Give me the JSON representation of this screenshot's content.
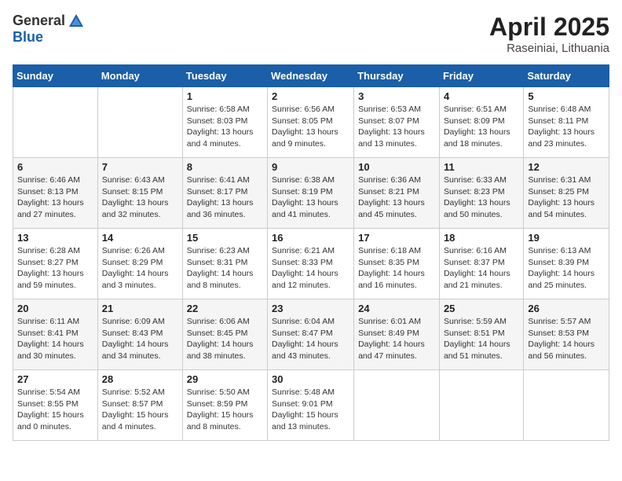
{
  "header": {
    "logo_general": "General",
    "logo_blue": "Blue",
    "month": "April 2025",
    "location": "Raseiniai, Lithuania"
  },
  "days_of_week": [
    "Sunday",
    "Monday",
    "Tuesday",
    "Wednesday",
    "Thursday",
    "Friday",
    "Saturday"
  ],
  "weeks": [
    [
      {
        "day": "",
        "info": ""
      },
      {
        "day": "",
        "info": ""
      },
      {
        "day": "1",
        "info": "Sunrise: 6:58 AM\nSunset: 8:03 PM\nDaylight: 13 hours\nand 4 minutes."
      },
      {
        "day": "2",
        "info": "Sunrise: 6:56 AM\nSunset: 8:05 PM\nDaylight: 13 hours\nand 9 minutes."
      },
      {
        "day": "3",
        "info": "Sunrise: 6:53 AM\nSunset: 8:07 PM\nDaylight: 13 hours\nand 13 minutes."
      },
      {
        "day": "4",
        "info": "Sunrise: 6:51 AM\nSunset: 8:09 PM\nDaylight: 13 hours\nand 18 minutes."
      },
      {
        "day": "5",
        "info": "Sunrise: 6:48 AM\nSunset: 8:11 PM\nDaylight: 13 hours\nand 23 minutes."
      }
    ],
    [
      {
        "day": "6",
        "info": "Sunrise: 6:46 AM\nSunset: 8:13 PM\nDaylight: 13 hours\nand 27 minutes."
      },
      {
        "day": "7",
        "info": "Sunrise: 6:43 AM\nSunset: 8:15 PM\nDaylight: 13 hours\nand 32 minutes."
      },
      {
        "day": "8",
        "info": "Sunrise: 6:41 AM\nSunset: 8:17 PM\nDaylight: 13 hours\nand 36 minutes."
      },
      {
        "day": "9",
        "info": "Sunrise: 6:38 AM\nSunset: 8:19 PM\nDaylight: 13 hours\nand 41 minutes."
      },
      {
        "day": "10",
        "info": "Sunrise: 6:36 AM\nSunset: 8:21 PM\nDaylight: 13 hours\nand 45 minutes."
      },
      {
        "day": "11",
        "info": "Sunrise: 6:33 AM\nSunset: 8:23 PM\nDaylight: 13 hours\nand 50 minutes."
      },
      {
        "day": "12",
        "info": "Sunrise: 6:31 AM\nSunset: 8:25 PM\nDaylight: 13 hours\nand 54 minutes."
      }
    ],
    [
      {
        "day": "13",
        "info": "Sunrise: 6:28 AM\nSunset: 8:27 PM\nDaylight: 13 hours\nand 59 minutes."
      },
      {
        "day": "14",
        "info": "Sunrise: 6:26 AM\nSunset: 8:29 PM\nDaylight: 14 hours\nand 3 minutes."
      },
      {
        "day": "15",
        "info": "Sunrise: 6:23 AM\nSunset: 8:31 PM\nDaylight: 14 hours\nand 8 minutes."
      },
      {
        "day": "16",
        "info": "Sunrise: 6:21 AM\nSunset: 8:33 PM\nDaylight: 14 hours\nand 12 minutes."
      },
      {
        "day": "17",
        "info": "Sunrise: 6:18 AM\nSunset: 8:35 PM\nDaylight: 14 hours\nand 16 minutes."
      },
      {
        "day": "18",
        "info": "Sunrise: 6:16 AM\nSunset: 8:37 PM\nDaylight: 14 hours\nand 21 minutes."
      },
      {
        "day": "19",
        "info": "Sunrise: 6:13 AM\nSunset: 8:39 PM\nDaylight: 14 hours\nand 25 minutes."
      }
    ],
    [
      {
        "day": "20",
        "info": "Sunrise: 6:11 AM\nSunset: 8:41 PM\nDaylight: 14 hours\nand 30 minutes."
      },
      {
        "day": "21",
        "info": "Sunrise: 6:09 AM\nSunset: 8:43 PM\nDaylight: 14 hours\nand 34 minutes."
      },
      {
        "day": "22",
        "info": "Sunrise: 6:06 AM\nSunset: 8:45 PM\nDaylight: 14 hours\nand 38 minutes."
      },
      {
        "day": "23",
        "info": "Sunrise: 6:04 AM\nSunset: 8:47 PM\nDaylight: 14 hours\nand 43 minutes."
      },
      {
        "day": "24",
        "info": "Sunrise: 6:01 AM\nSunset: 8:49 PM\nDaylight: 14 hours\nand 47 minutes."
      },
      {
        "day": "25",
        "info": "Sunrise: 5:59 AM\nSunset: 8:51 PM\nDaylight: 14 hours\nand 51 minutes."
      },
      {
        "day": "26",
        "info": "Sunrise: 5:57 AM\nSunset: 8:53 PM\nDaylight: 14 hours\nand 56 minutes."
      }
    ],
    [
      {
        "day": "27",
        "info": "Sunrise: 5:54 AM\nSunset: 8:55 PM\nDaylight: 15 hours\nand 0 minutes."
      },
      {
        "day": "28",
        "info": "Sunrise: 5:52 AM\nSunset: 8:57 PM\nDaylight: 15 hours\nand 4 minutes."
      },
      {
        "day": "29",
        "info": "Sunrise: 5:50 AM\nSunset: 8:59 PM\nDaylight: 15 hours\nand 8 minutes."
      },
      {
        "day": "30",
        "info": "Sunrise: 5:48 AM\nSunset: 9:01 PM\nDaylight: 15 hours\nand 13 minutes."
      },
      {
        "day": "",
        "info": ""
      },
      {
        "day": "",
        "info": ""
      },
      {
        "day": "",
        "info": ""
      }
    ]
  ]
}
